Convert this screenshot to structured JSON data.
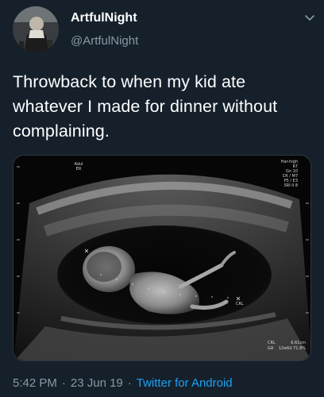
{
  "author": {
    "display_name": "ArtfulNight",
    "handle": "@ArtfulNight"
  },
  "tweet": {
    "text": "Throwback to when my kid ate whatever I made for dinner without complaining."
  },
  "media": {
    "overlay": {
      "top_right_lines": [
        "Har-high",
        "67",
        "Gn 10",
        "CR / M7",
        "P5 / E3",
        "SRI II 8"
      ],
      "top_left_lines": [
        "Adul",
        "ER"
      ],
      "crl_label": "CRL",
      "bottom_left_lines": [
        "CRL",
        "GA"
      ],
      "bottom_right_lines": [
        "6.61cm",
        "12w6d 71.8%"
      ]
    }
  },
  "footer": {
    "time": "5:42 PM",
    "date": "23 Jun 19",
    "separator": "·",
    "source": "Twitter for Android"
  },
  "colors": {
    "background": "#15202b",
    "secondary_text": "#8899a6",
    "link": "#1da1f2"
  }
}
